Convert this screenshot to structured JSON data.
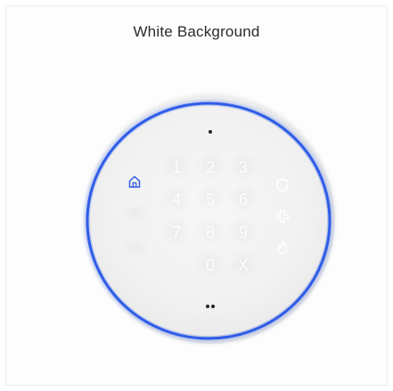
{
  "panel": {
    "title": "White Background"
  },
  "device": {
    "ring_color": "#2f5de8",
    "home_icon_color": "#2f5de8",
    "keys": [
      {
        "label": "1"
      },
      {
        "label": "2"
      },
      {
        "label": "3"
      },
      {
        "label": "4"
      },
      {
        "label": "5"
      },
      {
        "label": "6"
      },
      {
        "label": "7"
      },
      {
        "label": "8"
      },
      {
        "label": "9"
      },
      {
        "label": "0"
      },
      {
        "label": "X"
      }
    ],
    "icons": {
      "home": "home-icon",
      "shield": "shield-icon",
      "medical": "medical-cross-icon",
      "fire": "fire-icon"
    }
  }
}
